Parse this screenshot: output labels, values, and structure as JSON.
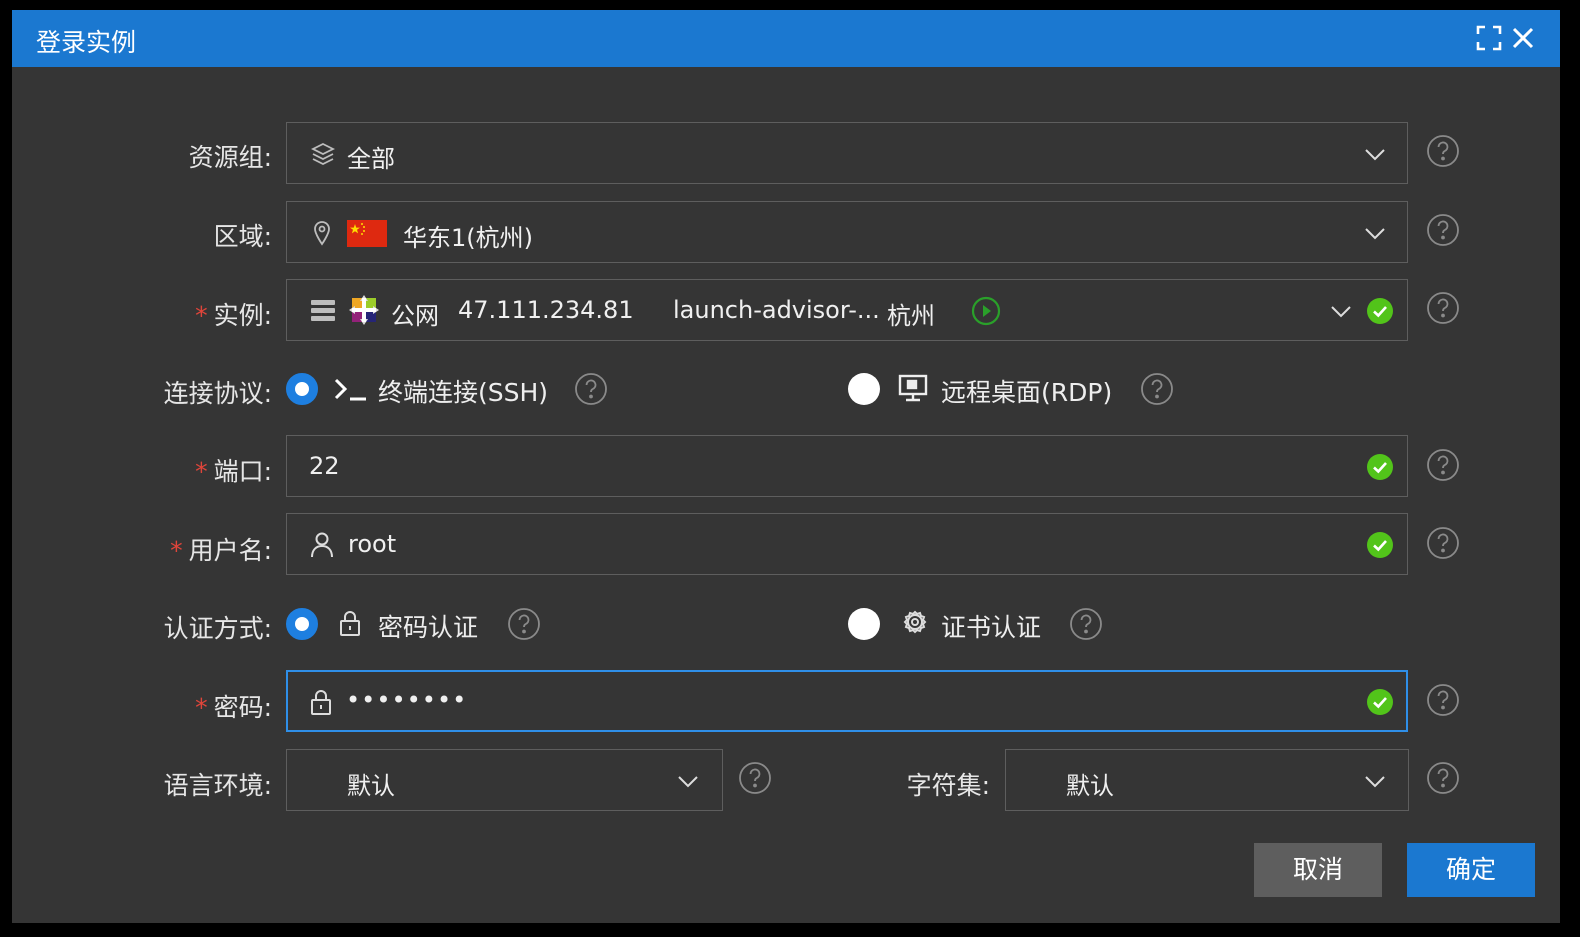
{
  "dialog": {
    "title": "登录实例",
    "icons": {
      "maximize": "maximize-icon",
      "close": "close-icon"
    }
  },
  "colors": {
    "accent": "#1b78d0",
    "success": "#52c41a",
    "required": "#e0453a",
    "background": "#353535"
  },
  "form": {
    "resource_group": {
      "label": "资源组:",
      "value": "全部",
      "icon": "layers-icon"
    },
    "region": {
      "label": "区域:",
      "value": "华东1(杭州)",
      "icon": "location-pin-icon",
      "flag": "china-flag-icon"
    },
    "instance": {
      "required_mark": "*",
      "label": "实例:",
      "network": "公网",
      "ip": "47.111.234.81",
      "name": "launch-advisor-...",
      "zone": "杭州",
      "status": "running",
      "os_icon": "centos-logo-icon"
    },
    "protocol": {
      "label": "连接协议:",
      "options": [
        {
          "label": "终端连接(SSH)",
          "icon": "terminal-icon",
          "selected": true
        },
        {
          "label": "远程桌面(RDP)",
          "icon": "monitor-icon",
          "selected": false
        }
      ]
    },
    "port": {
      "required_mark": "*",
      "label": "端口:",
      "value": "22"
    },
    "username": {
      "required_mark": "*",
      "label": "用户名:",
      "value": "root",
      "icon": "user-icon"
    },
    "auth": {
      "label": "认证方式:",
      "options": [
        {
          "label": "密码认证",
          "icon": "lock-icon",
          "selected": true
        },
        {
          "label": "证书认证",
          "icon": "certificate-icon",
          "selected": false
        }
      ]
    },
    "password": {
      "required_mark": "*",
      "label": "密码:",
      "value": "••••••••",
      "icon": "lock-icon"
    },
    "locale": {
      "label": "语言环境:",
      "value": "默认"
    },
    "charset": {
      "label": "字符集:",
      "value": "默认"
    }
  },
  "buttons": {
    "cancel": "取消",
    "confirm": "确定"
  }
}
